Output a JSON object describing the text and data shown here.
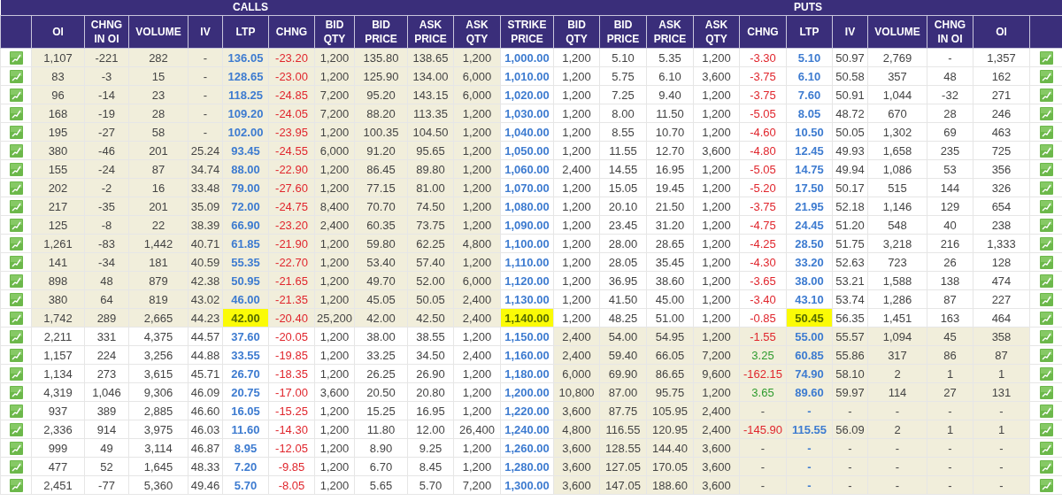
{
  "sections": {
    "calls": "CALLS",
    "puts": "PUTS"
  },
  "call_columns": [
    {
      "label": "OI",
      "kind": "num"
    },
    {
      "label": "CHNG IN OI",
      "kind": "num"
    },
    {
      "label": "VOLUME",
      "kind": "num"
    },
    {
      "label": "IV",
      "kind": "num"
    },
    {
      "label": "LTP",
      "kind": "ltp"
    },
    {
      "label": "CHNG",
      "kind": "chng"
    },
    {
      "label": "BID QTY",
      "kind": "num"
    },
    {
      "label": "BID PRICE",
      "kind": "num"
    },
    {
      "label": "ASK PRICE",
      "kind": "num"
    },
    {
      "label": "ASK QTY",
      "kind": "num"
    }
  ],
  "strike_column": {
    "label": "STRIKE PRICE"
  },
  "put_columns": [
    {
      "label": "BID QTY",
      "kind": "num"
    },
    {
      "label": "BID PRICE",
      "kind": "num"
    },
    {
      "label": "ASK PRICE",
      "kind": "num"
    },
    {
      "label": "ASK QTY",
      "kind": "num"
    },
    {
      "label": "CHNG",
      "kind": "chng"
    },
    {
      "label": "LTP",
      "kind": "ltp"
    },
    {
      "label": "IV",
      "kind": "num"
    },
    {
      "label": "VOLUME",
      "kind": "num"
    },
    {
      "label": "CHNG IN OI",
      "kind": "num"
    },
    {
      "label": "OI",
      "kind": "num"
    }
  ],
  "rows": [
    {
      "calls": [
        "1,107",
        "-221",
        "282",
        "-",
        "136.05",
        "-23.20",
        "1,200",
        "135.80",
        "138.65",
        "1,200"
      ],
      "strike": "1,000.00",
      "puts": [
        "1,200",
        "5.10",
        "5.35",
        "1,200",
        "-3.30",
        "5.10",
        "50.97",
        "2,769",
        "-",
        "1,357"
      ],
      "calls_itm": true,
      "puts_itm": false,
      "atm": false,
      "call_change": {
        "color": "#e0262d"
      },
      "put_change": {
        "color": "#e0262d"
      }
    },
    {
      "calls": [
        "83",
        "-3",
        "15",
        "-",
        "128.65",
        "-23.00",
        "1,200",
        "125.90",
        "134.00",
        "6,000"
      ],
      "strike": "1,010.00",
      "puts": [
        "1,200",
        "5.75",
        "6.10",
        "3,600",
        "-3.75",
        "6.10",
        "50.58",
        "357",
        "48",
        "162"
      ],
      "calls_itm": true,
      "puts_itm": false,
      "atm": false,
      "call_change": {
        "color": "#e0262d"
      },
      "put_change": {
        "color": "#e0262d"
      }
    },
    {
      "calls": [
        "96",
        "-14",
        "23",
        "-",
        "118.25",
        "-24.85",
        "7,200",
        "95.20",
        "143.15",
        "6,000"
      ],
      "strike": "1,020.00",
      "puts": [
        "1,200",
        "7.25",
        "9.40",
        "1,200",
        "-3.75",
        "7.60",
        "50.91",
        "1,044",
        "-32",
        "271"
      ],
      "calls_itm": true,
      "puts_itm": false,
      "atm": false,
      "call_change": {
        "color": "#e0262d"
      },
      "put_change": {
        "color": "#e0262d"
      }
    },
    {
      "calls": [
        "168",
        "-19",
        "28",
        "-",
        "109.20",
        "-24.05",
        "7,200",
        "88.20",
        "113.35",
        "1,200"
      ],
      "strike": "1,030.00",
      "puts": [
        "1,200",
        "8.00",
        "11.50",
        "1,200",
        "-5.05",
        "8.05",
        "48.72",
        "670",
        "28",
        "246"
      ],
      "calls_itm": true,
      "puts_itm": false,
      "atm": false,
      "call_change": {
        "color": "#e0262d"
      },
      "put_change": {
        "color": "#e0262d"
      }
    },
    {
      "calls": [
        "195",
        "-27",
        "58",
        "-",
        "102.00",
        "-23.95",
        "1,200",
        "100.35",
        "104.50",
        "1,200"
      ],
      "strike": "1,040.00",
      "puts": [
        "1,200",
        "8.55",
        "10.70",
        "1,200",
        "-4.60",
        "10.50",
        "50.05",
        "1,302",
        "69",
        "463"
      ],
      "calls_itm": true,
      "puts_itm": false,
      "atm": false,
      "call_change": {
        "color": "#e0262d"
      },
      "put_change": {
        "color": "#e0262d"
      }
    },
    {
      "calls": [
        "380",
        "-46",
        "201",
        "25.24",
        "93.45",
        "-24.55",
        "6,000",
        "91.20",
        "95.65",
        "1,200"
      ],
      "strike": "1,050.00",
      "puts": [
        "1,200",
        "11.55",
        "12.70",
        "3,600",
        "-4.80",
        "12.45",
        "49.93",
        "1,658",
        "235",
        "725"
      ],
      "calls_itm": true,
      "puts_itm": false,
      "atm": false,
      "call_change": {
        "color": "#e0262d"
      },
      "put_change": {
        "color": "#e0262d"
      }
    },
    {
      "calls": [
        "155",
        "-24",
        "87",
        "34.74",
        "88.00",
        "-22.90",
        "1,200",
        "86.45",
        "89.80",
        "1,200"
      ],
      "strike": "1,060.00",
      "puts": [
        "2,400",
        "14.55",
        "16.95",
        "1,200",
        "-5.05",
        "14.75",
        "49.94",
        "1,086",
        "53",
        "356"
      ],
      "calls_itm": true,
      "puts_itm": false,
      "atm": false,
      "call_change": {
        "color": "#e0262d"
      },
      "put_change": {
        "color": "#e0262d"
      }
    },
    {
      "calls": [
        "202",
        "-2",
        "16",
        "33.48",
        "79.00",
        "-27.60",
        "1,200",
        "77.15",
        "81.00",
        "1,200"
      ],
      "strike": "1,070.00",
      "puts": [
        "1,200",
        "15.05",
        "19.45",
        "1,200",
        "-5.20",
        "17.50",
        "50.17",
        "515",
        "144",
        "326"
      ],
      "calls_itm": true,
      "puts_itm": false,
      "atm": false,
      "call_change": {
        "color": "#e0262d"
      },
      "put_change": {
        "color": "#e0262d"
      }
    },
    {
      "calls": [
        "217",
        "-35",
        "201",
        "35.09",
        "72.00",
        "-24.75",
        "8,400",
        "70.70",
        "74.50",
        "1,200"
      ],
      "strike": "1,080.00",
      "puts": [
        "1,200",
        "20.10",
        "21.50",
        "1,200",
        "-3.75",
        "21.95",
        "52.18",
        "1,146",
        "129",
        "654"
      ],
      "calls_itm": true,
      "puts_itm": false,
      "atm": false,
      "call_change": {
        "color": "#e0262d"
      },
      "put_change": {
        "color": "#e0262d"
      }
    },
    {
      "calls": [
        "125",
        "-8",
        "22",
        "38.39",
        "66.90",
        "-23.20",
        "2,400",
        "60.35",
        "73.75",
        "1,200"
      ],
      "strike": "1,090.00",
      "puts": [
        "1,200",
        "23.45",
        "31.20",
        "1,200",
        "-4.75",
        "24.45",
        "51.20",
        "548",
        "40",
        "238"
      ],
      "calls_itm": true,
      "puts_itm": false,
      "atm": false,
      "call_change": {
        "color": "#e0262d"
      },
      "put_change": {
        "color": "#e0262d"
      }
    },
    {
      "calls": [
        "1,261",
        "-83",
        "1,442",
        "40.71",
        "61.85",
        "-21.90",
        "1,200",
        "59.80",
        "62.25",
        "4,800"
      ],
      "strike": "1,100.00",
      "puts": [
        "1,200",
        "28.00",
        "28.65",
        "1,200",
        "-4.25",
        "28.50",
        "51.75",
        "3,218",
        "216",
        "1,333"
      ],
      "calls_itm": true,
      "puts_itm": false,
      "atm": false,
      "call_change": {
        "color": "#e0262d"
      },
      "put_change": {
        "color": "#e0262d"
      }
    },
    {
      "calls": [
        "141",
        "-34",
        "181",
        "40.59",
        "55.35",
        "-22.70",
        "1,200",
        "53.40",
        "57.40",
        "1,200"
      ],
      "strike": "1,110.00",
      "puts": [
        "1,200",
        "28.05",
        "35.45",
        "1,200",
        "-4.30",
        "33.20",
        "52.63",
        "723",
        "26",
        "128"
      ],
      "calls_itm": true,
      "puts_itm": false,
      "atm": false,
      "call_change": {
        "color": "#e0262d"
      },
      "put_change": {
        "color": "#e0262d"
      }
    },
    {
      "calls": [
        "898",
        "48",
        "879",
        "42.38",
        "50.95",
        "-21.65",
        "1,200",
        "49.70",
        "52.00",
        "6,000"
      ],
      "strike": "1,120.00",
      "puts": [
        "1,200",
        "36.95",
        "38.60",
        "1,200",
        "-3.65",
        "38.00",
        "53.21",
        "1,588",
        "138",
        "474"
      ],
      "calls_itm": true,
      "puts_itm": false,
      "atm": false,
      "call_change": {
        "color": "#e0262d"
      },
      "put_change": {
        "color": "#e0262d"
      }
    },
    {
      "calls": [
        "380",
        "64",
        "819",
        "43.02",
        "46.00",
        "-21.35",
        "1,200",
        "45.05",
        "50.05",
        "2,400"
      ],
      "strike": "1,130.00",
      "puts": [
        "1,200",
        "41.50",
        "45.00",
        "1,200",
        "-3.40",
        "43.10",
        "53.74",
        "1,286",
        "87",
        "227"
      ],
      "calls_itm": true,
      "puts_itm": false,
      "atm": false,
      "call_change": {
        "color": "#e0262d"
      },
      "put_change": {
        "color": "#e0262d"
      }
    },
    {
      "calls": [
        "1,742",
        "289",
        "2,665",
        "44.23",
        "42.00",
        "-20.40",
        "25,200",
        "42.00",
        "42.50",
        "2,400"
      ],
      "strike": "1,140.00",
      "puts": [
        "1,200",
        "48.25",
        "51.00",
        "1,200",
        "-0.85",
        "50.45",
        "56.35",
        "1,451",
        "163",
        "464"
      ],
      "calls_itm": true,
      "puts_itm": false,
      "atm": true,
      "call_change": {
        "color": "#e0262d"
      },
      "put_change": {
        "color": "#e0262d"
      }
    },
    {
      "calls": [
        "2,211",
        "331",
        "4,375",
        "44.57",
        "37.60",
        "-20.05",
        "1,200",
        "38.00",
        "38.55",
        "1,200"
      ],
      "strike": "1,150.00",
      "puts": [
        "2,400",
        "54.00",
        "54.95",
        "1,200",
        "-1.55",
        "55.00",
        "55.57",
        "1,094",
        "45",
        "358"
      ],
      "calls_itm": false,
      "puts_itm": true,
      "atm": false,
      "call_change": {
        "color": "#e0262d"
      },
      "put_change": {
        "color": "#e0262d"
      }
    },
    {
      "calls": [
        "1,157",
        "224",
        "3,256",
        "44.88",
        "33.55",
        "-19.85",
        "1,200",
        "33.25",
        "34.50",
        "2,400"
      ],
      "strike": "1,160.00",
      "puts": [
        "2,400",
        "59.40",
        "66.05",
        "7,200",
        "3.25",
        "60.85",
        "55.86",
        "317",
        "86",
        "87"
      ],
      "calls_itm": false,
      "puts_itm": true,
      "atm": false,
      "call_change": {
        "color": "#e0262d"
      },
      "put_change": {
        "color": "#2e9b2e"
      }
    },
    {
      "calls": [
        "1,134",
        "273",
        "3,615",
        "45.71",
        "26.70",
        "-18.35",
        "1,200",
        "26.25",
        "26.90",
        "1,200"
      ],
      "strike": "1,180.00",
      "puts": [
        "6,000",
        "69.90",
        "86.65",
        "9,600",
        "-162.15",
        "74.90",
        "58.10",
        "2",
        "1",
        "1"
      ],
      "calls_itm": false,
      "puts_itm": true,
      "atm": false,
      "call_change": {
        "color": "#e0262d"
      },
      "put_change": {
        "color": "#e0262d"
      }
    },
    {
      "calls": [
        "4,319",
        "1,046",
        "9,306",
        "46.09",
        "20.75",
        "-17.00",
        "3,600",
        "20.50",
        "20.80",
        "1,200"
      ],
      "strike": "1,200.00",
      "puts": [
        "10,800",
        "87.00",
        "95.75",
        "1,200",
        "3.65",
        "89.60",
        "59.97",
        "114",
        "27",
        "131"
      ],
      "calls_itm": false,
      "puts_itm": true,
      "atm": false,
      "call_change": {
        "color": "#e0262d"
      },
      "put_change": {
        "color": "#2e9b2e"
      }
    },
    {
      "calls": [
        "937",
        "389",
        "2,885",
        "46.60",
        "16.05",
        "-15.25",
        "1,200",
        "15.25",
        "16.95",
        "1,200"
      ],
      "strike": "1,220.00",
      "puts": [
        "3,600",
        "87.75",
        "105.95",
        "2,400",
        "-",
        "-",
        "-",
        "-",
        "-",
        "-"
      ],
      "calls_itm": false,
      "puts_itm": true,
      "atm": false,
      "call_change": {
        "color": "#e0262d"
      }
    },
    {
      "calls": [
        "2,336",
        "914",
        "3,975",
        "46.03",
        "11.60",
        "-14.30",
        "1,200",
        "11.80",
        "12.00",
        "26,400"
      ],
      "strike": "1,240.00",
      "puts": [
        "4,800",
        "116.55",
        "120.95",
        "2,400",
        "-145.90",
        "115.55",
        "56.09",
        "2",
        "1",
        "1"
      ],
      "calls_itm": false,
      "puts_itm": true,
      "atm": false,
      "call_change": {
        "color": "#e0262d"
      },
      "put_change": {
        "color": "#e0262d"
      }
    },
    {
      "calls": [
        "999",
        "49",
        "3,114",
        "46.87",
        "8.95",
        "-12.05",
        "1,200",
        "8.90",
        "9.25",
        "1,200"
      ],
      "strike": "1,260.00",
      "puts": [
        "3,600",
        "128.55",
        "144.40",
        "3,600",
        "-",
        "-",
        "-",
        "-",
        "-",
        "-"
      ],
      "calls_itm": false,
      "puts_itm": true,
      "atm": false,
      "call_change": {
        "color": "#e0262d"
      }
    },
    {
      "calls": [
        "477",
        "52",
        "1,645",
        "48.33",
        "7.20",
        "-9.85",
        "1,200",
        "6.70",
        "8.45",
        "1,200"
      ],
      "strike": "1,280.00",
      "puts": [
        "3,600",
        "127.05",
        "170.05",
        "3,600",
        "-",
        "-",
        "-",
        "-",
        "-",
        "-"
      ],
      "calls_itm": false,
      "puts_itm": true,
      "atm": false,
      "call_change": {
        "color": "#e0262d"
      }
    },
    {
      "calls": [
        "2,451",
        "-77",
        "5,360",
        "49.46",
        "5.70",
        "-8.05",
        "1,200",
        "5.65",
        "5.70",
        "7,200"
      ],
      "strike": "1,300.00",
      "puts": [
        "3,600",
        "147.05",
        "188.60",
        "3,600",
        "-",
        "-",
        "-",
        "-",
        "-",
        "-"
      ],
      "calls_itm": false,
      "puts_itm": true,
      "atm": false,
      "call_change": {
        "color": "#e0262d"
      }
    }
  ]
}
